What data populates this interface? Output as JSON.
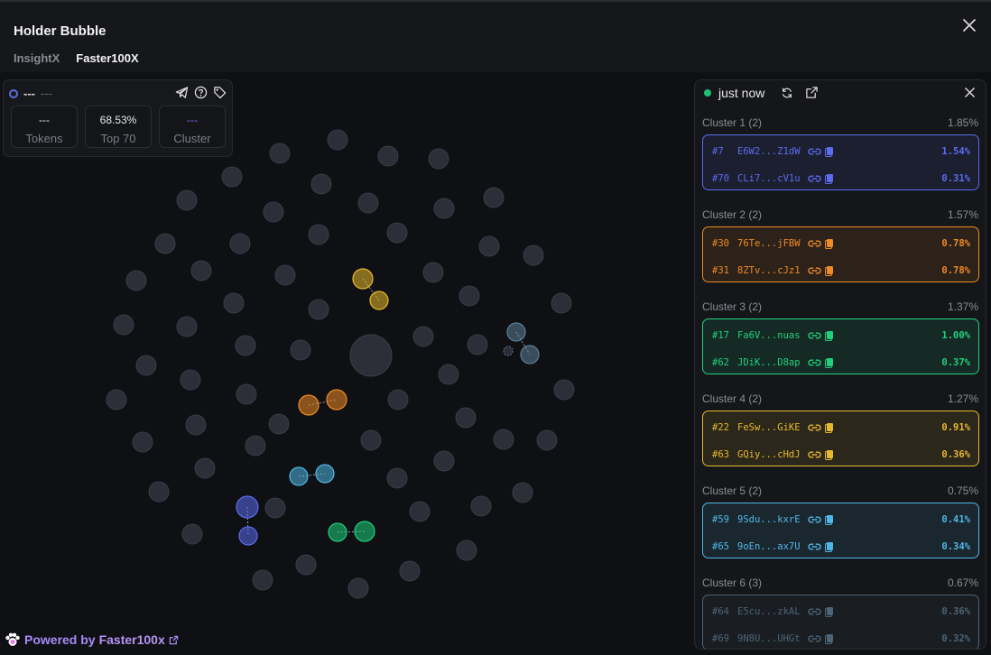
{
  "header": {
    "title": "Holder Bubble",
    "tabs": [
      {
        "label": "InsightX",
        "active": false
      },
      {
        "label": "Faster100X",
        "active": true
      }
    ]
  },
  "info_card": {
    "name": "---",
    "sub": "---",
    "stats": [
      {
        "value": "---",
        "label": "Tokens"
      },
      {
        "value": "68.53%",
        "label": "Top 70"
      },
      {
        "value": "---",
        "label": "Cluster"
      }
    ],
    "icons": [
      "telegram-icon",
      "help-icon",
      "tag-icon"
    ]
  },
  "panel": {
    "status": "just now",
    "clusters": [
      {
        "name": "Cluster 1 (2)",
        "total": "1.85%",
        "color": "#5b6cf0",
        "rows": [
          {
            "rank": "#7",
            "addr": "E6W2...Z1dW",
            "pct": "1.54%"
          },
          {
            "rank": "#70",
            "addr": "CLi7...cV1u",
            "pct": "0.31%"
          }
        ]
      },
      {
        "name": "Cluster 2 (2)",
        "total": "1.57%",
        "color": "#f08a24",
        "rows": [
          {
            "rank": "#30",
            "addr": "76Te...jFBW",
            "pct": "0.78%"
          },
          {
            "rank": "#31",
            "addr": "8ZTv...cJz1",
            "pct": "0.78%"
          }
        ]
      },
      {
        "name": "Cluster 3 (2)",
        "total": "1.37%",
        "color": "#1fd17c",
        "rows": [
          {
            "rank": "#17",
            "addr": "Fa6V...nuas",
            "pct": "1.00%"
          },
          {
            "rank": "#62",
            "addr": "JDiK...D8ap",
            "pct": "0.37%"
          }
        ]
      },
      {
        "name": "Cluster 4 (2)",
        "total": "1.27%",
        "color": "#e8b92c",
        "rows": [
          {
            "rank": "#22",
            "addr": "FeSw...GiKE",
            "pct": "0.91%"
          },
          {
            "rank": "#63",
            "addr": "GQiy...cHdJ",
            "pct": "0.36%"
          }
        ]
      },
      {
        "name": "Cluster 5 (2)",
        "total": "0.75%",
        "color": "#4fb7e6",
        "rows": [
          {
            "rank": "#59",
            "addr": "9Sdu...kxrE",
            "pct": "0.41%"
          },
          {
            "rank": "#65",
            "addr": "9oEn...ax7U",
            "pct": "0.34%"
          }
        ]
      },
      {
        "name": "Cluster 6 (3)",
        "total": "0.67%",
        "color": "#5f7f99",
        "rows": [
          {
            "rank": "#64",
            "addr": "E5cu...zkAL",
            "pct": "0.36%"
          },
          {
            "rank": "#69",
            "addr": "9N8U...UHGt",
            "pct": "0.32%"
          }
        ]
      }
    ]
  },
  "footer": {
    "prefix": "Powered by",
    "brand": "Faster100x"
  },
  "colors": {
    "bubble_default": "#2c2f37",
    "bubble_stroke": "#3a3d46"
  }
}
